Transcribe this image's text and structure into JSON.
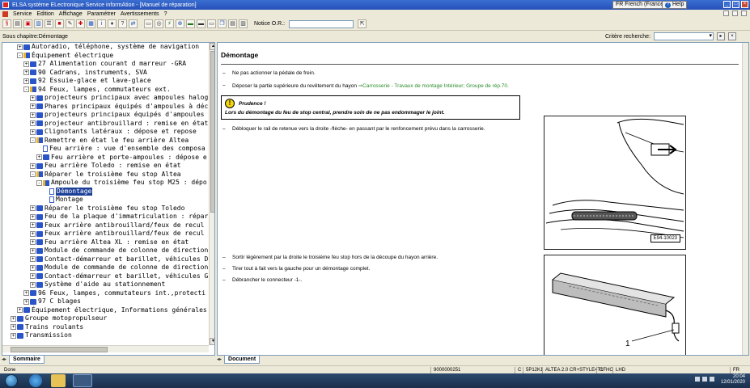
{
  "window": {
    "title": "ELSA système ELectronique Service informAtion - [Manuel de réparation]",
    "language": "FR French (France)",
    "help": "Help"
  },
  "menu": [
    "Service",
    "Edition",
    "Affichage",
    "Paramétrer",
    "Avertissements",
    "?"
  ],
  "toolbar": {
    "notice_label": "Notice O.R.:",
    "notice_value": ""
  },
  "subheader": {
    "breadcrumb": "Sous chapitre:Démontage",
    "search_label": "Critère recherche:",
    "search_value": ""
  },
  "tree": [
    {
      "indent": 3,
      "exp": "+",
      "icon": "book",
      "label": "Autoradio, téléphone, système de navigation"
    },
    {
      "indent": 3,
      "exp": "-",
      "icon": "openbook",
      "label": "Équipement électrique"
    },
    {
      "indent": 4,
      "exp": "+",
      "icon": "book",
      "label": "27 Alimentation courant d marreur -GRA"
    },
    {
      "indent": 4,
      "exp": "+",
      "icon": "book",
      "label": "90 Cadrans, instruments, SVA"
    },
    {
      "indent": 4,
      "exp": "+",
      "icon": "book",
      "label": "92 Essuie-glace et lave-glace"
    },
    {
      "indent": 4,
      "exp": "-",
      "icon": "openbook",
      "label": "94 Feux, lampes, commutateurs ext."
    },
    {
      "indent": 5,
      "exp": "+",
      "icon": "book",
      "label": "projecteurs principaux avec ampoules halogè"
    },
    {
      "indent": 5,
      "exp": "+",
      "icon": "book",
      "label": "Phares principaux équipés d'ampoules à déc"
    },
    {
      "indent": 5,
      "exp": "+",
      "icon": "book",
      "label": "projecteurs principaux équipés d'ampoules"
    },
    {
      "indent": 5,
      "exp": "+",
      "icon": "book",
      "label": "projecteur antibrouillard : remise en état"
    },
    {
      "indent": 5,
      "exp": "+",
      "icon": "book",
      "label": "Clignotants latéraux : dépose et repose"
    },
    {
      "indent": 5,
      "exp": "-",
      "icon": "openbook",
      "label": "Remettre en état le feu arrière Altea"
    },
    {
      "indent": 6,
      "exp": "",
      "icon": "page",
      "label": "Feu arrière : vue d'ensemble des composa"
    },
    {
      "indent": 6,
      "exp": "+",
      "icon": "book",
      "label": "Feu arrière et porte-ampoules : dépose e"
    },
    {
      "indent": 5,
      "exp": "+",
      "icon": "book",
      "label": "Feu arrière Toledo : remise en état"
    },
    {
      "indent": 5,
      "exp": "-",
      "icon": "openbook",
      "label": "Réparer le troisième feu stop Altea"
    },
    {
      "indent": 6,
      "exp": "-",
      "icon": "openbook",
      "label": "Ampoule du troisième feu stop M25 : dépo"
    },
    {
      "indent": 7,
      "exp": "",
      "icon": "page",
      "label": "Démontage",
      "selected": true
    },
    {
      "indent": 7,
      "exp": "",
      "icon": "page",
      "label": "Montage"
    },
    {
      "indent": 5,
      "exp": "+",
      "icon": "book",
      "label": "Réparer le troisième feu stop Toledo"
    },
    {
      "indent": 5,
      "exp": "+",
      "icon": "book",
      "label": "Feu de la plaque d'immatriculation : répar"
    },
    {
      "indent": 5,
      "exp": "+",
      "icon": "book",
      "label": "Feux arrière antibrouillard/feux de recul"
    },
    {
      "indent": 5,
      "exp": "+",
      "icon": "book",
      "label": "Feux arrière antibrouillard/feux de recul"
    },
    {
      "indent": 5,
      "exp": "+",
      "icon": "book",
      "label": "Feu arrière Altea XL : remise en état"
    },
    {
      "indent": 5,
      "exp": "+",
      "icon": "book",
      "label": "Module de commande de colonne de direction"
    },
    {
      "indent": 5,
      "exp": "+",
      "icon": "book",
      "label": "Contact-démarreur et barillet, véhicules D"
    },
    {
      "indent": 5,
      "exp": "+",
      "icon": "book",
      "label": "Module de commande de colonne de direction"
    },
    {
      "indent": 5,
      "exp": "+",
      "icon": "book",
      "label": "Contact-démarreur et barillet, véhicules G"
    },
    {
      "indent": 5,
      "exp": "+",
      "icon": "book",
      "label": "Système d'aide au stationnement"
    },
    {
      "indent": 4,
      "exp": "+",
      "icon": "book",
      "label": "96 Feux, lampes, commutateurs int.,protecti"
    },
    {
      "indent": 4,
      "exp": "+",
      "icon": "book",
      "label": "97 C blages"
    },
    {
      "indent": 3,
      "exp": "+",
      "icon": "book",
      "label": "Équipement électrique, Informations générales"
    },
    {
      "indent": 2,
      "exp": "+",
      "icon": "book",
      "label": "Groupe motopropulseur"
    },
    {
      "indent": 2,
      "exp": "+",
      "icon": "book",
      "label": "Trains roulants"
    },
    {
      "indent": 2,
      "exp": "+",
      "icon": "book",
      "label": "Transmission"
    }
  ],
  "left_tab": "Sommaire",
  "right_tab": "Document",
  "doc": {
    "title": "Démontage",
    "step1": "Ne pas actionner la pédale de frein.",
    "step2_text": "Déposer la partie supérieure du revêtement du hayon ",
    "step2_link": "⇒Carrosserie - Travaux de montage Intérieur; Groupe de rép.70.",
    "caution_title": "Prudence !",
    "caution_text": "Lors du démontage du feu de stop central, prendre soin de ne pas endommager le joint.",
    "step3": "Débloquer le rail de retenue vers la droite -flèche- en passant par le renfoncement prévu dans la carrosserie.",
    "fig1_label": "E94-10023",
    "step4": "Sortir légèrement par la droite le troisième feu stop hors de la découpe du hayon arrière.",
    "step5": "Tirer tout à fait vers la gauche pour un démontage complet.",
    "step6": "Débrancher le connecteur -1-.",
    "fig2_callout": "1"
  },
  "status": {
    "left": "Done",
    "code": "9000000251",
    "c": "C",
    "model": "5P12K1",
    "vehicle": "ALTEA 2.0 CR+STYLE4T1",
    "engine": "CFHC",
    "lhd": "LHD",
    "lang": "FR"
  },
  "taskbar": {
    "time": "20:04",
    "date": "12/01/2020"
  }
}
